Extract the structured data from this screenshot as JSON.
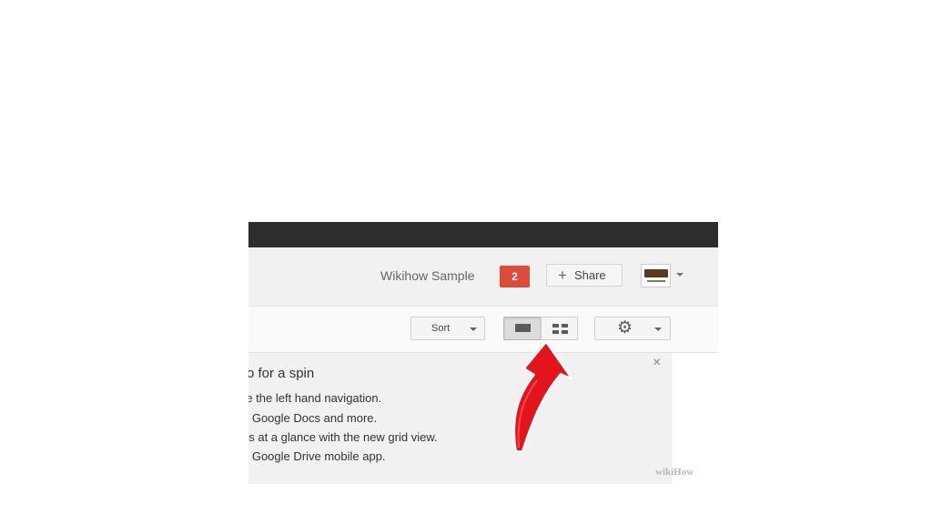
{
  "header": {
    "doc_title": "Wikihow Sample",
    "notification_count": "2",
    "share_label": "Share",
    "share_icon": "+"
  },
  "toolbar": {
    "sort_label": "Sort",
    "gear_icon": "⚙"
  },
  "promo": {
    "title": "o for a spin",
    "lines": [
      "re the left hand navigation.",
      "e Google Docs and more.",
      "es at a glance with the new grid view.",
      "e Google Drive mobile app."
    ],
    "close_icon": "×"
  },
  "watermark": "wikiHow",
  "colors": {
    "notification": "#dd4b39",
    "topbar": "#2d2d2d",
    "arrow": "#e3141b"
  }
}
